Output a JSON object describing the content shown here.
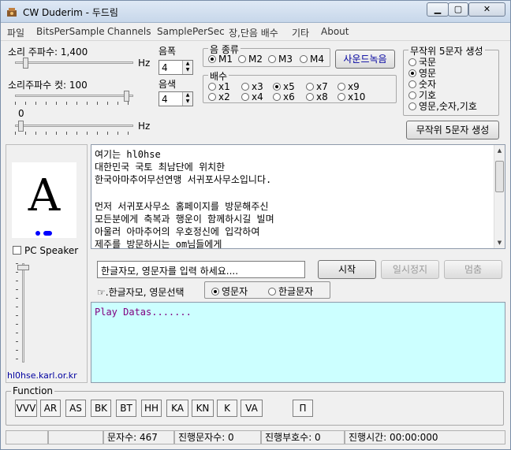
{
  "window": {
    "title": "CW Duderim - 두드림"
  },
  "menu": [
    "파일",
    "BitsPerSample",
    "Channels",
    "SamplePerSec",
    "장,단음 배수",
    "기타",
    "About"
  ],
  "controls": {
    "freq_label": "소리 주파수: 1,400",
    "freq_unit": "Hz",
    "cutoff_label": "소리주파수 컷: 100",
    "cutoff_value": "0",
    "cutoff_unit": "Hz",
    "width_label": "음폭",
    "width_value": "4",
    "color_label": "음색",
    "color_value": "4"
  },
  "sound_type": {
    "title": "음 종류",
    "options": [
      "M1",
      "M2",
      "M3",
      "M4"
    ],
    "selected": "M1"
  },
  "record_button": "사운드녹음",
  "multiplier": {
    "title": "배수",
    "options": [
      "x1",
      "x3",
      "x5",
      "x7",
      "x9",
      "x2",
      "x4",
      "x6",
      "x8",
      "x10"
    ],
    "selected": "x5"
  },
  "random": {
    "title": "무작위 5문자 생성",
    "options": [
      "국문",
      "영문",
      "숫자",
      "기호",
      "영문,숫자,기호"
    ],
    "selected": "영문",
    "button": "무작위 5문자 생성"
  },
  "display": {
    "letter": "A",
    "pc_speaker": "PC Speaker",
    "site": "hl0hse.karl.or.kr"
  },
  "memo_lines": [
    "여기는 hl0hse",
    "대한민국 국토 최남단에 위치한",
    "한국아마추어무선연맹 서귀포사무소입니다.",
    "",
    "먼저 서귀포사무소 홈페이지를 방문해주신",
    "모든분에게 축복과 행운이 함께하시길 빌며",
    "아울러 아마추어의 우호정신에 입각하여",
    "제주를 방문하시는 om님들에게"
  ],
  "input": {
    "text": "한글자모, 영문자를 입력 하세요....",
    "start": "시작",
    "pause": "일시정지",
    "stop": "멈춤"
  },
  "select": {
    "label": "☞.한글자모, 영문선택",
    "options": [
      "영문자",
      "한글문자"
    ],
    "selected": "영문자"
  },
  "play_text": "Play Datas.......",
  "function": {
    "title": "Function",
    "buttons": [
      "VVV",
      "AR",
      "AS",
      "BK",
      "BT",
      "HH",
      "KA",
      "KN",
      "K",
      "VA",
      "Π"
    ]
  },
  "status": {
    "chars": "문자수: 467",
    "progress_chars": "진행문자수: 0",
    "progress_signs": "진행부호수: 0",
    "progress_time": "진행시간: 00:00:000"
  }
}
